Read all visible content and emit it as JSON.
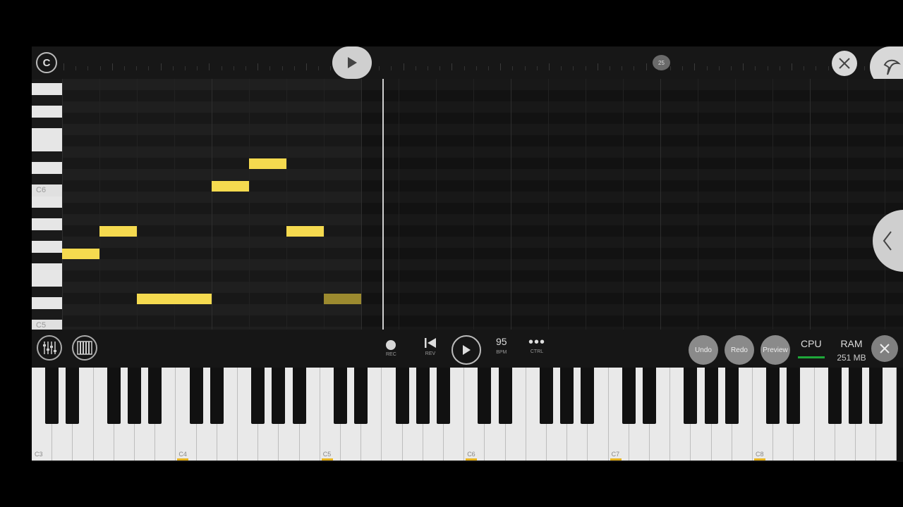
{
  "topbar": {
    "logo_icon": "fl-logo-icon",
    "bar_marker": "25",
    "play_icon": "play-icon",
    "close_icon": "close-icon",
    "app_icon": "fruit-logo-icon"
  },
  "roll": {
    "key_labels": {
      "c6": "C6",
      "c5": "C5"
    },
    "notes": [
      {
        "start": 0,
        "length": 1,
        "row": 8,
        "ghost": false
      },
      {
        "start": 1,
        "length": 1,
        "row": 7,
        "ghost": false
      },
      {
        "start": 2,
        "length": 2,
        "row": 10,
        "ghost": false
      },
      {
        "start": 4,
        "length": 1,
        "row": 5,
        "ghost": false
      },
      {
        "start": 5,
        "length": 1,
        "row": 4,
        "ghost": false
      },
      {
        "start": 6,
        "length": 1,
        "row": 7,
        "ghost": false
      },
      {
        "start": 7,
        "length": 1,
        "row": 10,
        "ghost": true
      }
    ],
    "collapse_icon": "chevron-left-icon"
  },
  "transport": {
    "mixer_icon": "mixer-icon",
    "piano_icon": "piano-icon",
    "rec_label": "REC",
    "rev_label": "REV",
    "bpm_value": "95",
    "bpm_label": "BPM",
    "ctrl_label": "CTRL",
    "ctrl_icon": "•••",
    "undo_label": "Undo",
    "redo_label": "Redo",
    "preview_label": "Preview",
    "cpu_label": "CPU",
    "ram_label": "RAM",
    "ram_value": "251 MB",
    "accent_color": "#f5da4f",
    "cpu_color": "#1ea83a"
  },
  "keyboard": {
    "octave_labels": [
      "C3",
      "C4",
      "C5",
      "C6",
      "C7",
      "C8"
    ]
  }
}
